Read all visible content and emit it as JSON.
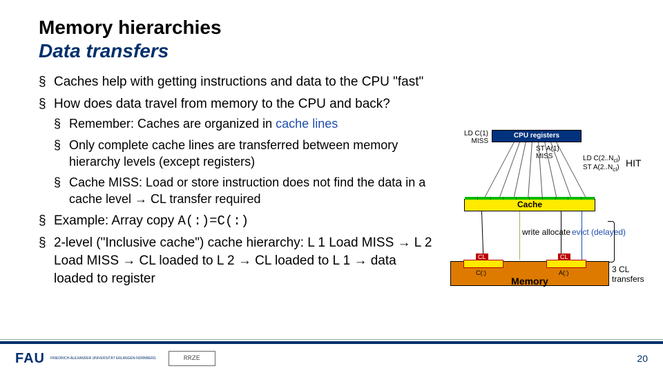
{
  "header": {
    "title": "Memory hierarchies",
    "subtitle": "Data transfers"
  },
  "bullets": {
    "b1": "Caches help with getting instructions and data to the CPU \"fast\"",
    "b2": "How does data travel from memory to the CPU and back?",
    "b2a_pre": "Remember: Caches are organized in ",
    "b2a_em": "cache lines",
    "b2b": "Only complete cache lines are transferred between memory hierarchy levels (except registers)",
    "b2c": "Cache MISS: Load or store instruction does not find the data in a cache level → CL transfer required",
    "b3_pre": "Example: Array copy ",
    "b3_code": "A(:)=C(:)",
    "b4": "2-level (\"Inclusive cache\") cache hierarchy: L 1 Load MISS → L 2 Load MISS → CL loaded to L 2 → CL loaded to L 1 → data loaded to register"
  },
  "diagram": {
    "cpu_registers": "CPU registers",
    "cache": "Cache",
    "memory": "Memory",
    "ld_c1": "LD C(1)",
    "miss": "MISS",
    "st_a1": "ST A(1)",
    "ld_c2": "LD C(2..N",
    "st_a2": "ST A(2..N",
    "sub": "cl",
    "close": ")",
    "hit": "HIT",
    "write_allocate": "write allocate",
    "evict": "evict (delayed)",
    "cl": "CL",
    "c_arr": "C(:)",
    "a_arr": "A(:)",
    "transfers": "3 CL transfers"
  },
  "footer": {
    "fau": "FAU",
    "fau_sub": "Friedrich-Alexander Universität Erlangen-Nürnberg",
    "rrze": "RRZE",
    "page": "20"
  }
}
